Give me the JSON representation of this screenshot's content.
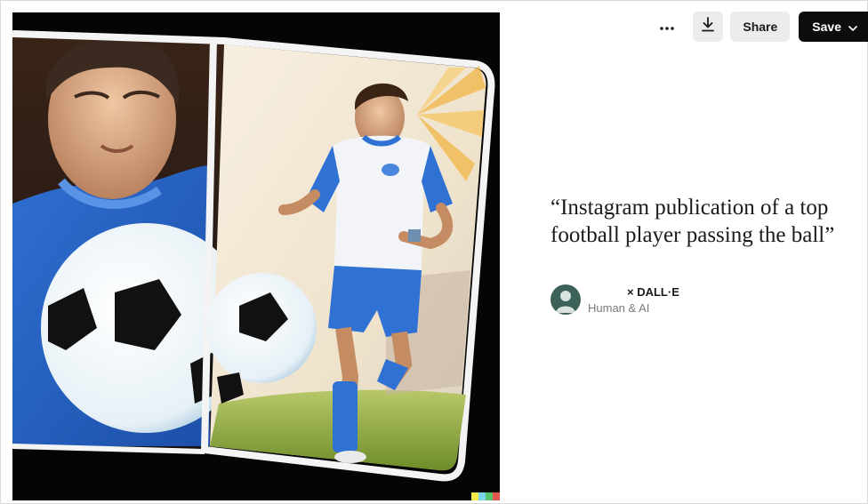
{
  "toolbar": {
    "more_icon": "ellipsis-icon",
    "download_icon": "download-icon",
    "share_label": "Share",
    "save_label": "Save",
    "save_chevron_icon": "chevron-down-icon"
  },
  "artwork": {
    "description_icon": "generated-image",
    "signature_colors": [
      "#f2e94e",
      "#7ad3e8",
      "#58c36f",
      "#e4564d",
      "#4e66d8"
    ]
  },
  "caption": {
    "prompt_text": "“Instagram publication of a top football player passing the ball”",
    "creator_name": "× DALL·E",
    "creator_subtitle": "Human & AI"
  },
  "colors": {
    "save_bg": "#0d0d0d",
    "button_bg": "#ececec",
    "avatar_bg": "#3c6158"
  }
}
